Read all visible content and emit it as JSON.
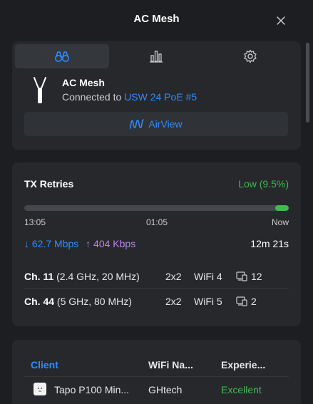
{
  "header": {
    "title": "AC Mesh"
  },
  "tabs": [
    {
      "icon": "binoculars-icon",
      "active": true
    },
    {
      "icon": "bar-chart-icon",
      "active": false
    },
    {
      "icon": "gear-icon",
      "active": false
    }
  ],
  "device": {
    "name": "AC Mesh",
    "connected_prefix": "Connected to",
    "uplink": "USW 24 PoE #5",
    "airview_label": "AirView"
  },
  "tx": {
    "label": "TX Retries",
    "status": "Low (9.5%)",
    "retry_percent": 9.5,
    "bar_filled_fraction": 0.015,
    "time_labels": [
      "13:05",
      "01:05",
      "Now"
    ],
    "down_rate": "62.7 Mbps",
    "up_rate": "404 Kbps",
    "uptime": "12m 21s"
  },
  "channels": [
    {
      "channel": "Ch. 11",
      "detail": "(2.4 GHz, 20 MHz)",
      "mimo": "2x2",
      "standard": "WiFi 4",
      "clients": "12"
    },
    {
      "channel": "Ch. 44",
      "detail": "(5 GHz, 80 MHz)",
      "mimo": "2x2",
      "standard": "WiFi 5",
      "clients": "2"
    }
  ],
  "clients_table": {
    "headers": [
      "Client",
      "WiFi Na...",
      "Experie..."
    ],
    "rows": [
      {
        "client": "Tapo P100 Min...",
        "wifi": "GHtech",
        "experience": "Excellent"
      }
    ]
  },
  "colors": {
    "accent": "#2d8cff",
    "good": "#3fb950",
    "upload": "#c080f0",
    "background": "#1c1e21",
    "card": "#26282c"
  }
}
